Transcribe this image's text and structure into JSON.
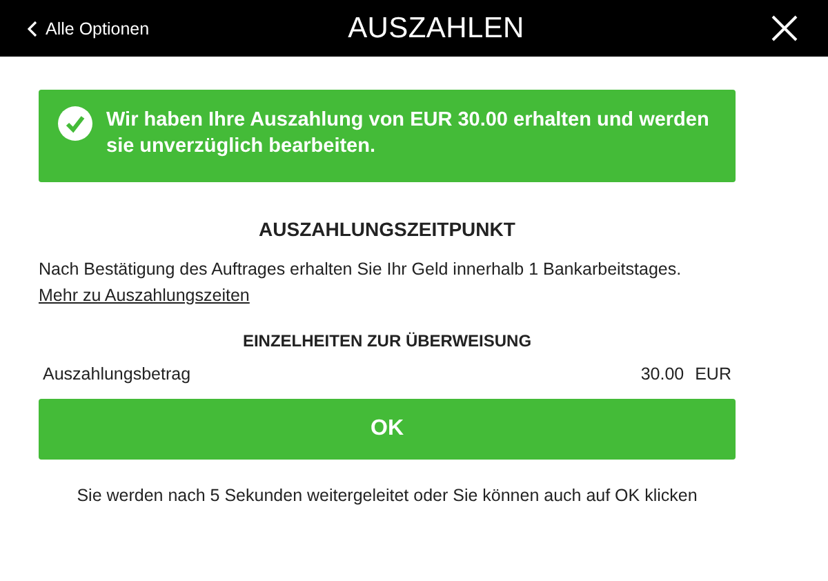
{
  "header": {
    "back_label": "Alle Optionen",
    "title": "AUSZAHLEN"
  },
  "banner": {
    "message": "Wir haben Ihre Auszahlung von EUR 30.00 erhalten und werden sie unverzüglich bearbeiten."
  },
  "timing": {
    "heading": "AUSZAHLUNGSZEITPUNKT",
    "text": "Nach Bestätigung des Auftrages erhalten Sie Ihr Geld innerhalb 1 Bankarbeitstages.",
    "link": "Mehr zu Auszahlungszeiten"
  },
  "details": {
    "heading": "EINZELHEITEN ZUR ÜBERWEISUNG",
    "rows": [
      {
        "label": "Auszahlungsbetrag",
        "amount": "30.00",
        "currency": "EUR"
      }
    ]
  },
  "ok_button": "OK",
  "redirect_note": "Sie werden nach 5 Sekunden weitergeleitet oder Sie können auch auf OK klicken"
}
